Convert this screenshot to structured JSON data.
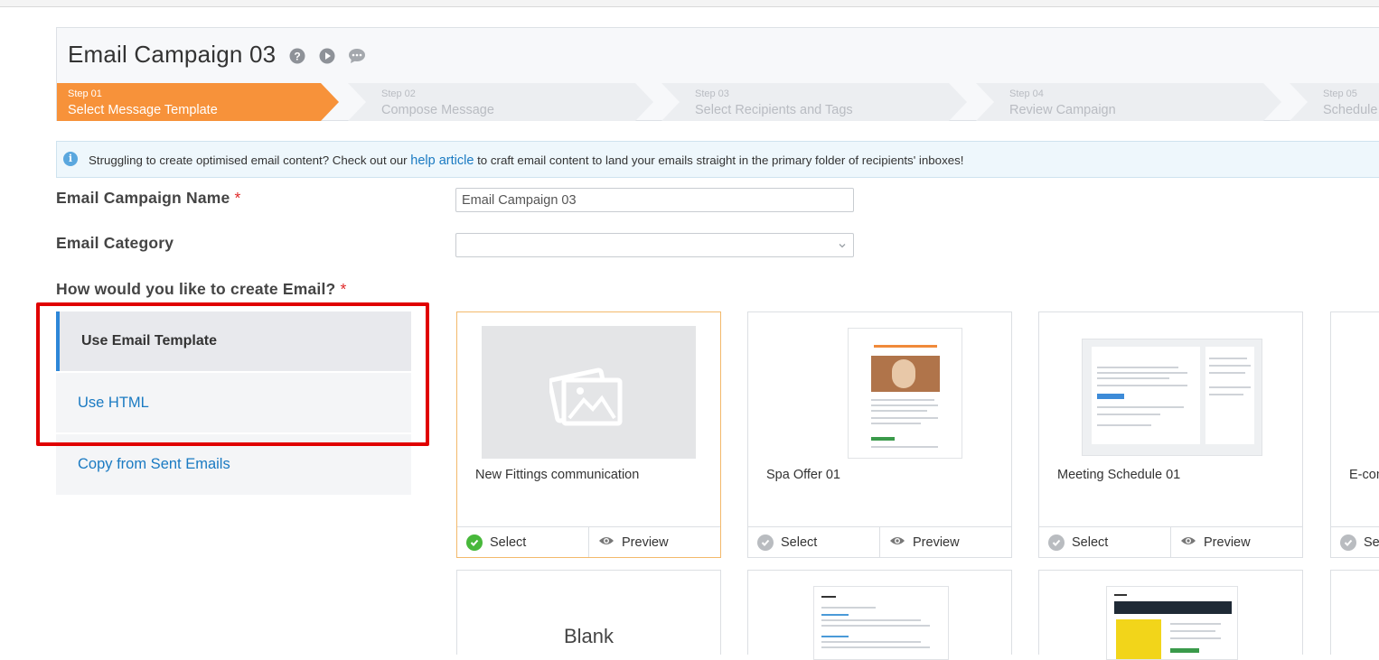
{
  "header": {
    "title": "Email Campaign 03",
    "icons": [
      "help-icon",
      "play-icon",
      "chat-icon"
    ]
  },
  "steps": [
    {
      "num": "Step 01",
      "label": "Select Message Template",
      "active": true
    },
    {
      "num": "Step 02",
      "label": "Compose Message",
      "active": false
    },
    {
      "num": "Step 03",
      "label": "Select Recipients and Tags",
      "active": false
    },
    {
      "num": "Step 04",
      "label": "Review Campaign",
      "active": false
    },
    {
      "num": "Step 05",
      "label": "Schedule",
      "active": false
    }
  ],
  "banner": {
    "text_before": "Struggling to create optimised email content? Check out our",
    "link": "help article",
    "text_after": "to craft email content to land your emails straight in the primary folder of recipients' inboxes!"
  },
  "form": {
    "name_label": "Email Campaign Name",
    "name_value": "Email Campaign 03",
    "category_label": "Email Category",
    "category_value": "",
    "create_label": "How would you like to create Email?",
    "required_mark": "*"
  },
  "create_options": [
    {
      "label": "Use Email Template",
      "active": true
    },
    {
      "label": "Use HTML",
      "active": false
    },
    {
      "label": "Copy from Sent Emails",
      "active": false
    }
  ],
  "templates": [
    {
      "name": "New Fittings communication",
      "selected": true
    },
    {
      "name": "Spa Offer 01",
      "selected": false
    },
    {
      "name": "Meeting Schedule 01",
      "selected": false
    },
    {
      "name": "E-com",
      "selected": false
    }
  ],
  "template_actions": {
    "select": "Select",
    "preview": "Preview"
  },
  "second_row": {
    "blank_label": "Blank"
  },
  "colors": {
    "accent_orange": "#f7923a",
    "link_blue": "#1a7ac2",
    "active_border": "#2d86d8",
    "highlight_red": "#e00000",
    "check_green": "#48b83b"
  }
}
